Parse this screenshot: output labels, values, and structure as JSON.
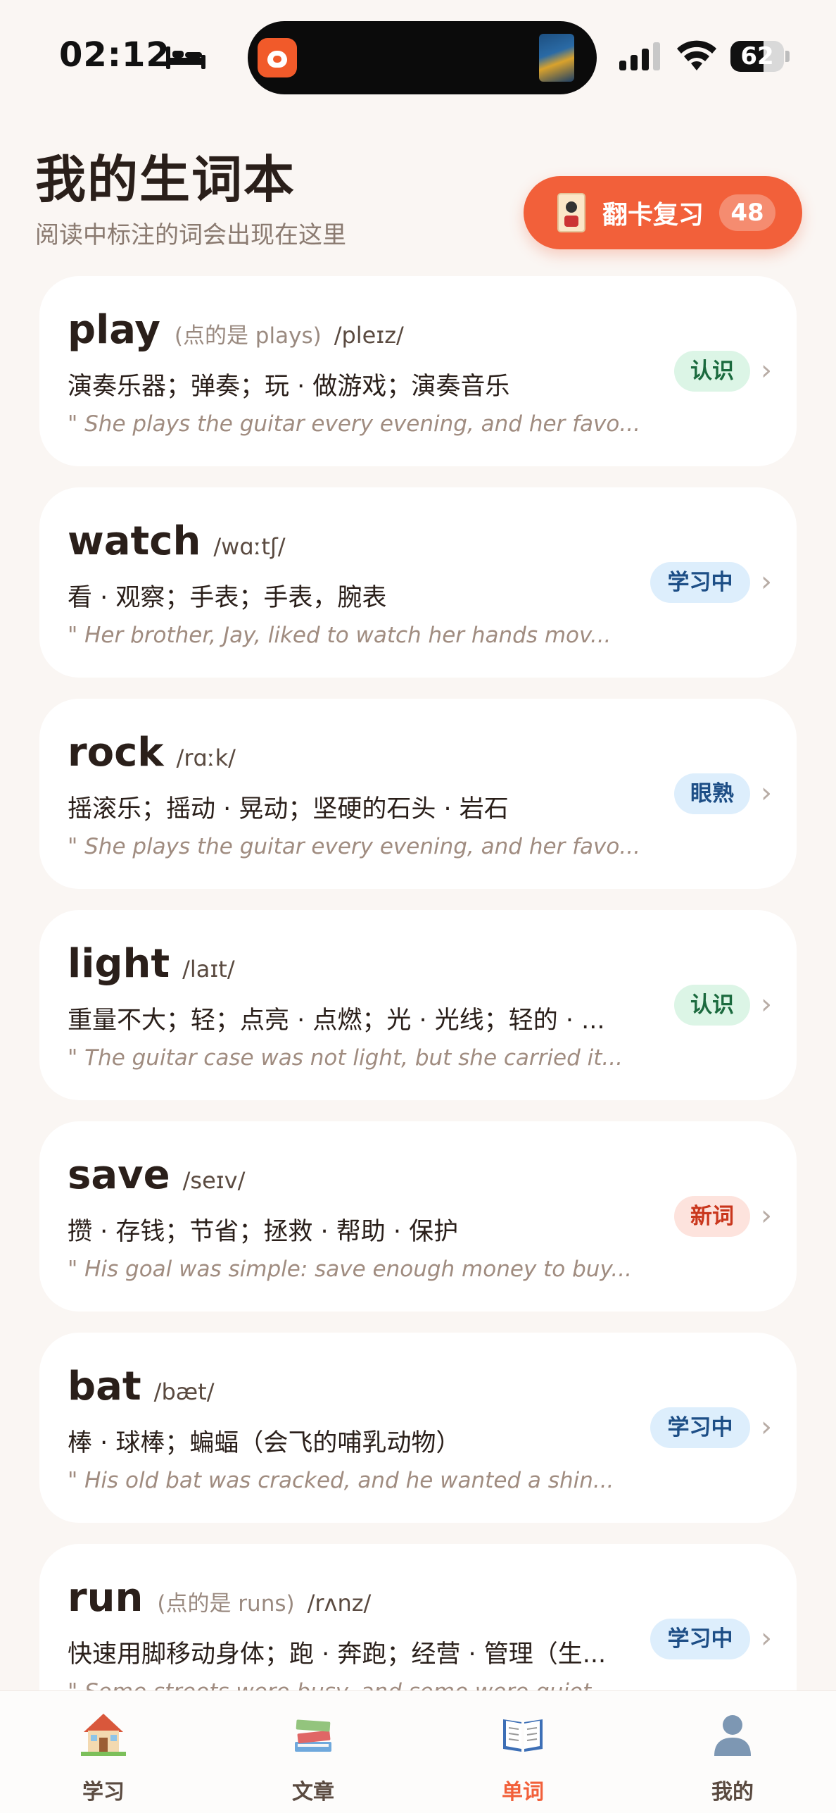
{
  "status_bar": {
    "time": "02:12",
    "battery": "62",
    "battery_level": 0.62
  },
  "header": {
    "title": "我的生词本",
    "subtitle": "阅读中标注的词会出现在这里",
    "review_button": {
      "label": "翻卡复习",
      "count": "48"
    }
  },
  "words": [
    {
      "word": "play",
      "hint": "(点的是 plays)",
      "phonetic": "/pleɪz/",
      "meaning": "演奏乐器；弹奏；玩 · 做游戏；演奏音乐",
      "example": "\" She plays the guitar every evening, and her favo...",
      "status": "认识",
      "status_type": "know"
    },
    {
      "word": "watch",
      "hint": "",
      "phonetic": "/wɑːtʃ/",
      "meaning": "看 · 观察；手表；手表，腕表",
      "example": "\" Her brother, Jay, liked to watch her hands mov...",
      "status": "学习中",
      "status_type": "learning"
    },
    {
      "word": "rock",
      "hint": "",
      "phonetic": "/rɑːk/",
      "meaning": "摇滚乐；摇动 · 晃动；坚硬的石头 · 岩石",
      "example": "\" She plays the guitar every evening, and her favo...",
      "status": "眼熟",
      "status_type": "familiar"
    },
    {
      "word": "light",
      "hint": "",
      "phonetic": "/laɪt/",
      "meaning": "重量不大；轻；点亮 · 点燃；光 · 光线；轻的 · ...",
      "example": "\" The guitar case was not light, but she carried it...",
      "status": "认识",
      "status_type": "know"
    },
    {
      "word": "save",
      "hint": "",
      "phonetic": "/seɪv/",
      "meaning": "攒 · 存钱；节省；拯救 · 帮助 · 保护",
      "example": "\" His goal was simple: save enough money to buy...",
      "status": "新词",
      "status_type": "new"
    },
    {
      "word": "bat",
      "hint": "",
      "phonetic": "/bæt/",
      "meaning": "棒 · 球棒；蝙蝠（会飞的哺乳动物）",
      "example": "\" His old bat was cracked, and he wanted a shin...",
      "status": "学习中",
      "status_type": "learning"
    },
    {
      "word": "run",
      "hint": "(点的是 runs)",
      "phonetic": "/rʌnz/",
      "meaning": "快速用脚移动身体；跑 · 奔跑；经营 · 管理（生...",
      "example": "\" Some streets were busy, and some were quiet...",
      "status": "学习中",
      "status_type": "learning"
    }
  ],
  "tabs": [
    {
      "label": "学习",
      "icon": "house-icon",
      "active": false
    },
    {
      "label": "文章",
      "icon": "books-icon",
      "active": false
    },
    {
      "label": "单词",
      "icon": "open-book-icon",
      "active": true
    },
    {
      "label": "我的",
      "icon": "person-icon",
      "active": false
    }
  ],
  "colors": {
    "accent": "#f2603a",
    "background": "#faf6f3",
    "badge_know_bg": "#dcf5e6",
    "badge_learning_bg": "#ddeefc",
    "badge_new_bg": "#fde3dd"
  }
}
